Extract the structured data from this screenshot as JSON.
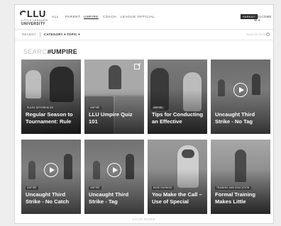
{
  "header": {
    "logo": {
      "name": "LLU",
      "line1": "LITTLE LEAGUE®",
      "line2": "UNIVERSITY"
    },
    "nav": [
      "ALL",
      "PARENT",
      "UMPIRE",
      "COACH",
      "LEAGUE OFFICIAL"
    ],
    "active_nav": "UMPIRE",
    "parent_button": "PARENT",
    "welcome": "WELCOME W ▾"
  },
  "filters": {
    "recent": "RECENT",
    "category": "CATEGORY ▾",
    "topic": "TOPIC ▾",
    "search_placeholder": "Search here"
  },
  "search": {
    "label": "SEARCH",
    "term": "#UMPIRE"
  },
  "cards": [
    {
      "tag": "RULES DIFFERENCES",
      "title": "Regular Season to Tournament: Rule"
    },
    {
      "tag": "UMPIRE",
      "title": "LLU Umpire Quiz 101"
    },
    {
      "tag": "UMPIRE",
      "title": "Tips for Conducting an Effective"
    },
    {
      "tag": "",
      "title": "Uncaught Third Strike - No Tag"
    },
    {
      "tag": "UMPIRE",
      "title": "Uncaught Third Strike - No Catch"
    },
    {
      "tag": "UMPIRE",
      "title": "Uncaught Third Strike - Tag"
    },
    {
      "tag": "BASE RUNNING",
      "title": "You Make the Call – Use of Special"
    },
    {
      "tag": "TRAINING AND EDUCATION",
      "title": "Formal Training Makes Little"
    }
  ],
  "load_more": "LOAD MORE",
  "colors": {
    "header_dark": "#2d2d2d",
    "tag_bg": "#3a3a3a",
    "search_label": "#bdbdbd"
  }
}
